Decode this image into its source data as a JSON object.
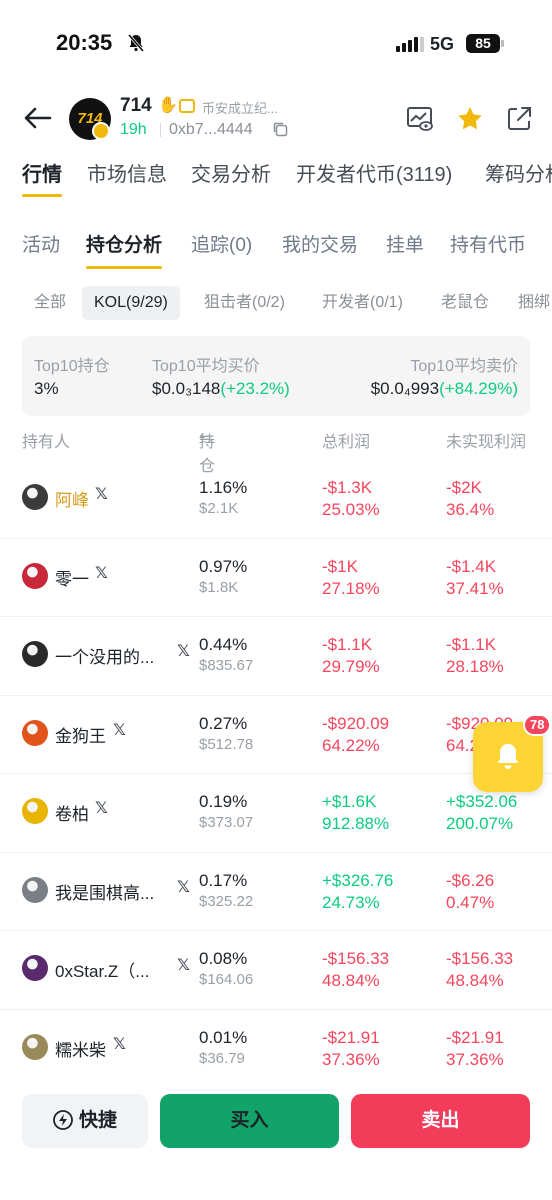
{
  "status_bar": {
    "time": "20:35",
    "network": "5G",
    "battery": "85"
  },
  "token": {
    "name": "714",
    "avatar_text": "714",
    "description": "币安成立纪...",
    "age": "19h",
    "address": "0xb7...4444"
  },
  "main_tabs": [
    "行情",
    "市场信息",
    "交易分析",
    "开发者代币(3119)",
    "筹码分析"
  ],
  "sub_tabs": [
    "活动",
    "持仓分析",
    "追踪(0)",
    "我的交易",
    "挂单",
    "持有代币"
  ],
  "filters": [
    "全部",
    "KOL(9/29)",
    "狙击者(0/2)",
    "开发者(0/1)",
    "老鼠仓",
    "捆绑"
  ],
  "summary": {
    "top10_holding_label": "Top10持仓",
    "top10_holding_value": "3%",
    "avg_buy_label": "Top10平均买价",
    "avg_buy_value": "$0.0₃148",
    "avg_buy_change": "(+23.2%)",
    "avg_sell_label": "Top10平均卖价",
    "avg_sell_value": "$0.0₄993",
    "avg_sell_change": "(+84.29%)"
  },
  "table": {
    "headers": {
      "holder": "持有人",
      "position": "持仓",
      "total_profit": "总利润",
      "unrealized": "未实现利润"
    },
    "rows": [
      {
        "name": "阿峰",
        "pct": "1.16%",
        "usd": "$2.1K",
        "profit": "-$1.3K",
        "profit_pct": "25.03%",
        "unreal": "-$2K",
        "unreal_pct": "36.4%",
        "profit_sign": "neg",
        "unreal_sign": "neg",
        "avatar_color": "#3b3b3b",
        "name_color": "#d89b1a"
      },
      {
        "name": "零一",
        "pct": "0.97%",
        "usd": "$1.8K",
        "profit": "-$1K",
        "profit_pct": "27.18%",
        "unreal": "-$1.4K",
        "unreal_pct": "37.41%",
        "profit_sign": "neg",
        "unreal_sign": "neg",
        "avatar_color": "#c8283a",
        "name_color": "#1e2329"
      },
      {
        "name": "一个没用的...",
        "pct": "0.44%",
        "usd": "$835.67",
        "profit": "-$1.1K",
        "profit_pct": "29.79%",
        "unreal": "-$1.1K",
        "unreal_pct": "28.18%",
        "profit_sign": "neg",
        "unreal_sign": "neg",
        "avatar_color": "#2a2a2a",
        "name_color": "#1e2329"
      },
      {
        "name": "金狗王",
        "pct": "0.27%",
        "usd": "$512.78",
        "profit": "-$920.09",
        "profit_pct": "64.22%",
        "unreal": "-$920.09",
        "unreal_pct": "64.22%",
        "profit_sign": "neg",
        "unreal_sign": "neg",
        "avatar_color": "#e0541c",
        "name_color": "#1e2329"
      },
      {
        "name": "卷柏",
        "pct": "0.19%",
        "usd": "$373.07",
        "profit": "+$1.6K",
        "profit_pct": "912.88%",
        "unreal": "+$352.06",
        "unreal_pct": "200.07%",
        "profit_sign": "pos",
        "unreal_sign": "pos",
        "avatar_color": "#e8b400",
        "name_color": "#1e2329"
      },
      {
        "name": "我是围棋高...",
        "pct": "0.17%",
        "usd": "$325.22",
        "profit": "+$326.76",
        "profit_pct": "24.73%",
        "unreal": "-$6.26",
        "unreal_pct": "0.47%",
        "profit_sign": "pos",
        "unreal_sign": "neg",
        "avatar_color": "#7a7f85",
        "name_color": "#1e2329"
      },
      {
        "name": "0xStar.Z（...",
        "pct": "0.08%",
        "usd": "$164.06",
        "profit": "-$156.33",
        "profit_pct": "48.84%",
        "unreal": "-$156.33",
        "unreal_pct": "48.84%",
        "profit_sign": "neg",
        "unreal_sign": "neg",
        "avatar_color": "#5a2a6e",
        "name_color": "#1e2329"
      },
      {
        "name": "糯米柴",
        "pct": "0.01%",
        "usd": "$36.79",
        "profit": "-$21.91",
        "profit_pct": "37.36%",
        "unreal": "-$21.91",
        "unreal_pct": "37.36%",
        "profit_sign": "neg",
        "unreal_sign": "neg",
        "avatar_color": "#9a8a5a",
        "name_color": "#1e2329"
      }
    ]
  },
  "float_badge": "78",
  "bottom": {
    "quick": "快捷",
    "buy": "买入",
    "sell": "卖出"
  },
  "colors": {
    "accent": "#f0b90b",
    "up": "#0ecb81",
    "down": "#f6465d",
    "buy": "#11a36a",
    "sell": "#f23c5a"
  },
  "icons": [
    "back-arrow-icon",
    "copy-icon",
    "chart-watch-icon",
    "star-icon",
    "share-icon",
    "x-logo-icon",
    "bell-icon",
    "lightning-icon",
    "swap-arrows-icon"
  ]
}
